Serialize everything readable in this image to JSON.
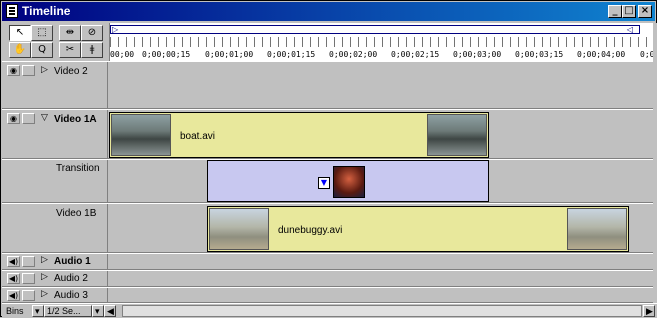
{
  "window": {
    "title": "Timeline",
    "controls": [
      "minimize",
      "maximize",
      "close"
    ]
  },
  "tools": [
    {
      "name": "selection-tool",
      "glyph": "↖",
      "selected": true
    },
    {
      "name": "range-select-tool",
      "glyph": "⬚",
      "selected": false
    },
    {
      "name": "track-tool",
      "glyph": "‡‡",
      "selected": false
    },
    {
      "name": "fade-tool",
      "glyph": "⊘",
      "selected": false
    },
    {
      "name": "hand-tool",
      "glyph": "✋",
      "selected": false
    },
    {
      "name": "zoom-tool",
      "glyph": "🔍",
      "selected": false
    },
    {
      "name": "razor-tool",
      "glyph": "✂",
      "selected": false
    },
    {
      "name": "in-out-tool",
      "glyph": "⦁",
      "selected": false
    }
  ],
  "ruler": {
    "labels": [
      "00;00",
      "0;00;00;15",
      "0;00;01;00",
      "0;00;01;15",
      "0;00;02;00",
      "0;00;02;15",
      "0;00;03;00",
      "0;00;03;15",
      "0;00;04;00",
      "0;0"
    ]
  },
  "tracks": {
    "video2": {
      "label": "Video 2"
    },
    "video1a": {
      "label": "Video 1A",
      "clip": "boat.avi"
    },
    "transition": {
      "label": "Transition"
    },
    "video1b": {
      "label": "Video 1B",
      "clip": "dunebuggy.avi"
    },
    "audio1": {
      "label": "Audio 1"
    },
    "audio2": {
      "label": "Audio 2"
    },
    "audio3": {
      "label": "Audio 3"
    }
  },
  "bottom": {
    "bins_label": "Bins",
    "zoom_label": "1/2 Se..."
  }
}
